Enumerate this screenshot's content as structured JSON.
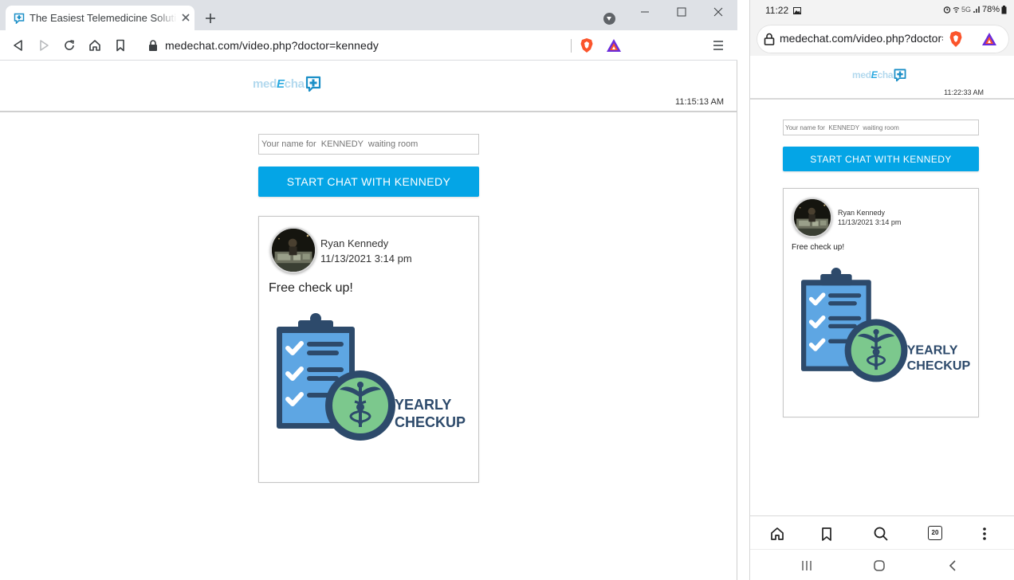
{
  "desktop": {
    "tab": {
      "title": "The Easiest Telemedicine Solution",
      "favicon": "medechat-favicon-icon"
    },
    "toolbar": {
      "url": "medechat.com/video.php?doctor=kennedy",
      "icons": [
        "back-icon",
        "forward-icon",
        "reload-icon",
        "home-icon",
        "bookmark-icon",
        "lock-icon",
        "brave-shields-icon",
        "brave-rewards-icon",
        "menu-icon"
      ]
    },
    "window_controls": [
      "minimize-icon",
      "maximize-icon",
      "close-icon"
    ],
    "page": {
      "logo": {
        "pre": "med",
        "mid": "E",
        "post": "cha"
      },
      "time": "11:15:13 AM"
    }
  },
  "mobile": {
    "status": {
      "time": "11:22",
      "network": "5G",
      "battery": "78%"
    },
    "url": "medechat.com/video.php?doctor=kennedy",
    "page": {
      "logo": {
        "pre": "med",
        "mid": "E",
        "post": "cha"
      },
      "time": "11:22:33 AM"
    },
    "bottom_nav": [
      "home-icon",
      "bookmark-icon",
      "search-icon",
      "tabs-icon",
      "more-icon"
    ],
    "tabs_count": "20",
    "system_nav": [
      "recent-apps-icon",
      "home-circle-icon",
      "back-icon"
    ]
  },
  "waiting_room": {
    "name_placeholder": "Your name for  KENNEDY  waiting room",
    "start_button": "START CHAT WITH KENNEDY"
  },
  "post": {
    "author": "Ryan Kennedy",
    "date": "11/13/2021 3:14 pm",
    "text": "Free check up!",
    "image": {
      "line1": "YEARLY",
      "line2": "CHECKUP"
    }
  },
  "colors": {
    "accent": "#04a5e6",
    "clipboard": "#2d4a6b",
    "paper": "#5ea6e3",
    "badge": "#7cc88d"
  }
}
